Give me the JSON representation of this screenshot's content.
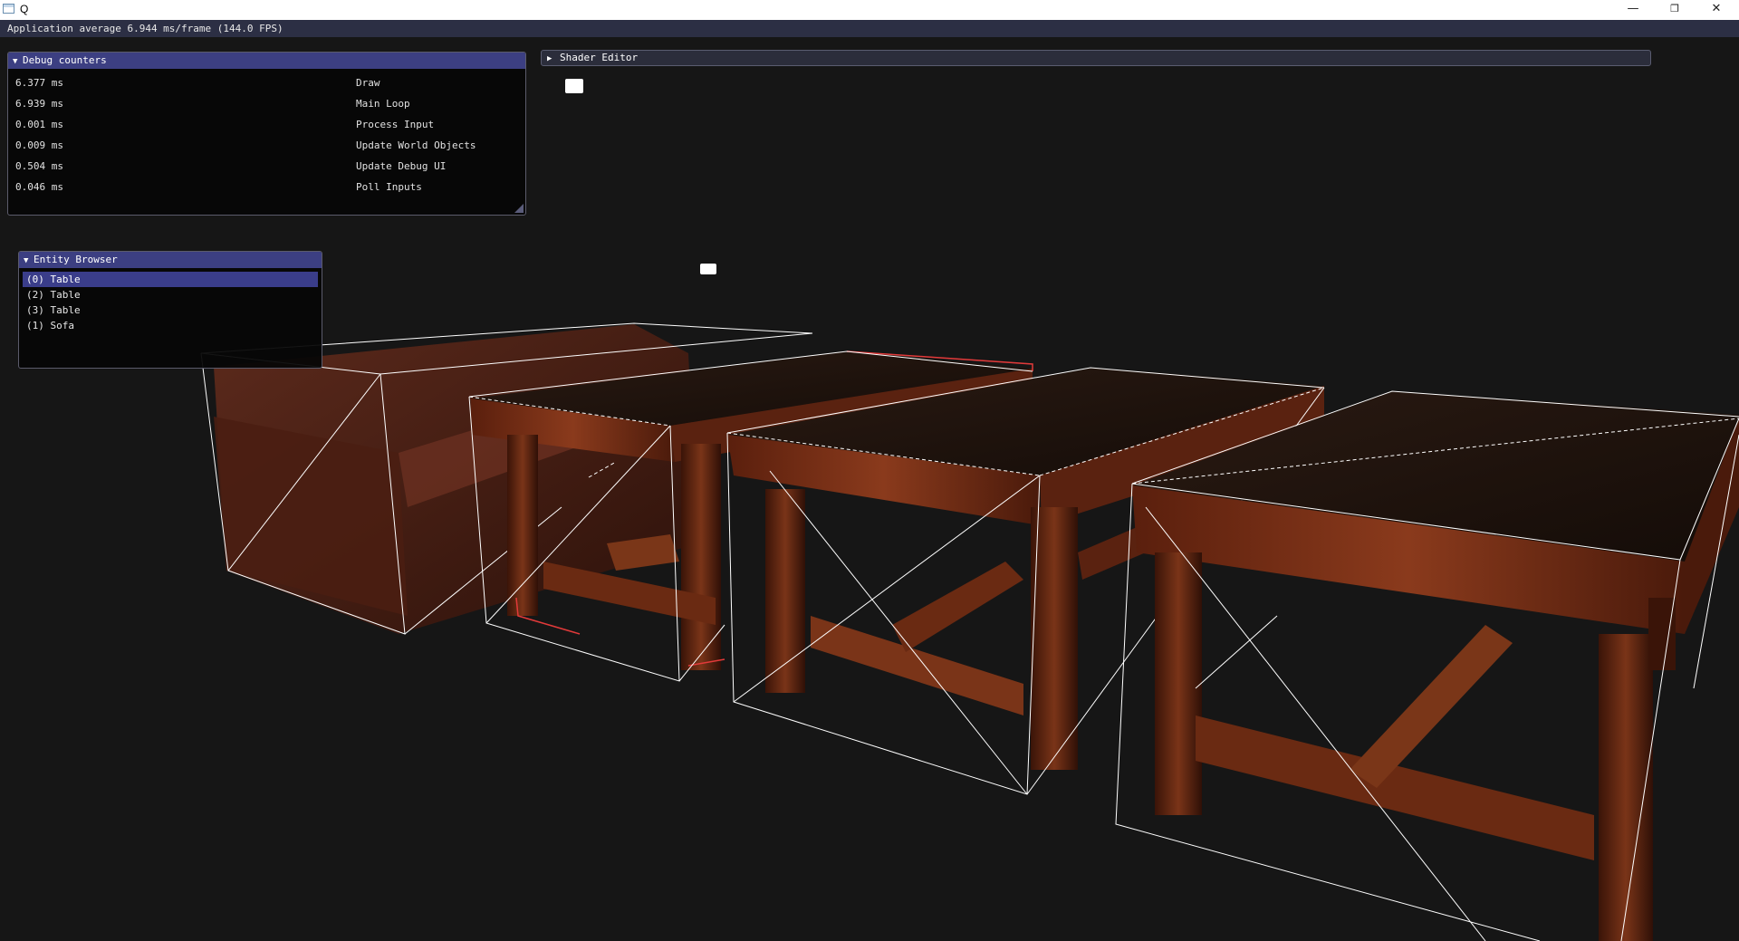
{
  "window": {
    "title": "Q",
    "minimize_glyph": "—",
    "maximize_glyph": "❐",
    "close_glyph": "✕"
  },
  "menubar": {
    "status": "Application average 6.944 ms/frame (144.0 FPS)"
  },
  "debug_counters": {
    "title": "Debug counters",
    "rows": [
      {
        "time": "6.377 ms",
        "label": "Draw"
      },
      {
        "time": "6.939 ms",
        "label": "Main Loop"
      },
      {
        "time": "0.001 ms",
        "label": "Process Input"
      },
      {
        "time": "0.009 ms",
        "label": "Update World Objects"
      },
      {
        "time": "0.504 ms",
        "label": "Update Debug UI"
      },
      {
        "time": "0.046 ms",
        "label": "Poll Inputs"
      }
    ]
  },
  "shader_editor": {
    "title": "Shader Editor",
    "collapsed": true
  },
  "entity_browser": {
    "title": "Entity Browser",
    "items": [
      {
        "label": "(0) Table",
        "selected": true
      },
      {
        "label": "(2) Table",
        "selected": false
      },
      {
        "label": "(3) Table",
        "selected": false
      },
      {
        "label": "(1) Sofa",
        "selected": false
      }
    ]
  },
  "scene": {
    "objects": [
      "sofa",
      "table",
      "table",
      "table"
    ],
    "selected_object": "(0) Table",
    "bbox_color": "#ffffff",
    "selection_color": "#e23a3a",
    "background": "#161616"
  },
  "icons": {
    "expanded": "▼",
    "collapsed": "▶"
  }
}
